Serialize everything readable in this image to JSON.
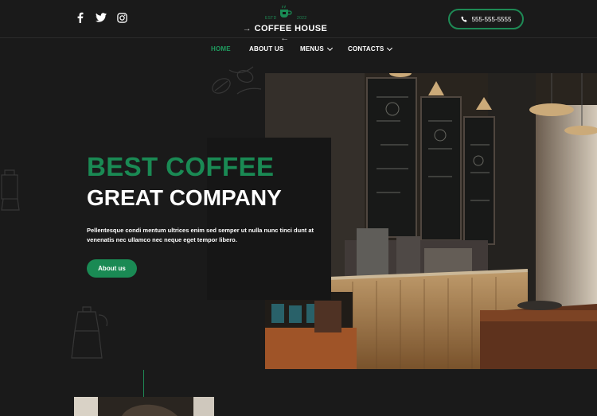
{
  "header": {
    "social": [
      "facebook-icon",
      "twitter-icon",
      "instagram-icon"
    ],
    "logo": {
      "estd": "ESTD",
      "year": "2022",
      "name": "COFFEE HOUSE"
    },
    "phone": "555-555-5555"
  },
  "nav": {
    "items": [
      {
        "label": "HOME",
        "active": true
      },
      {
        "label": "ABOUT US"
      },
      {
        "label": "MENUS",
        "dropdown": true
      },
      {
        "label": "CONTACTS",
        "dropdown": true
      }
    ]
  },
  "hero": {
    "title_line1": "BEST COFFEE",
    "title_line2": "GREAT COMPANY",
    "text": "Pellentesque condi mentum ultrices enim sed semper ut nulla nunc tinci dunt at venenatis nec ullamco nec neque eget tempor libero.",
    "button": "About us"
  },
  "colors": {
    "accent": "#1a8a54",
    "background": "#1a1a1a"
  }
}
